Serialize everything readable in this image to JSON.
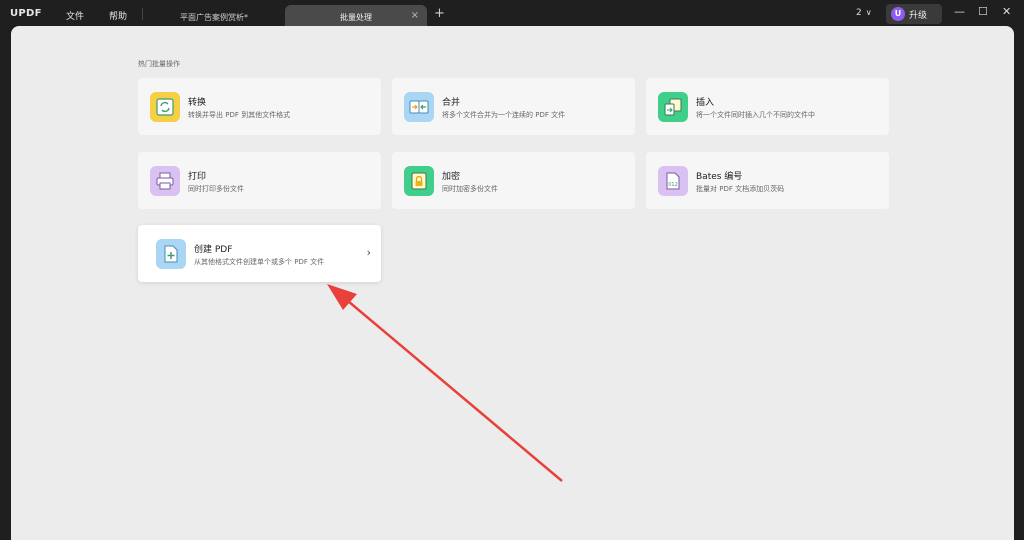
{
  "app": {
    "logo": "UPDF",
    "menu": [
      "文件",
      "帮助"
    ]
  },
  "tabs": [
    {
      "label": "平面广告案例赏析*",
      "active": false
    },
    {
      "label": "批量处理",
      "active": true,
      "close": "×"
    }
  ],
  "new_tab": "+",
  "page_indicator": {
    "value": "2",
    "chevron": "∨"
  },
  "upgrade": {
    "badge": "U",
    "label": "升级"
  },
  "window_controls": {
    "minimize": "—",
    "maximize": "☐",
    "close": "✕"
  },
  "section_title": "热门批量操作",
  "cards": [
    {
      "title": "转换",
      "desc": "转换并导出 PDF 到其他文件格式",
      "icon": "convert-icon",
      "color": "#f6cf45"
    },
    {
      "title": "合并",
      "desc": "将多个文件合并为一个连续的 PDF 文件",
      "icon": "merge-icon",
      "color": "#a9d6f2"
    },
    {
      "title": "插入",
      "desc": "将一个文件同时插入几个不同的文件中",
      "icon": "insert-icon",
      "color": "#3fcf8b"
    },
    {
      "title": "打印",
      "desc": "同时打印多份文件",
      "icon": "print-icon",
      "color": "#d9c2f2"
    },
    {
      "title": "加密",
      "desc": "同时加密多份文件",
      "icon": "lock-icon",
      "color": "#3fcf8b"
    },
    {
      "title": "Bates 编号",
      "desc": "批量对 PDF 文档添加贝茨码",
      "icon": "bates-icon",
      "color": "#d9c2f2"
    },
    {
      "title": "创建 PDF",
      "desc": "从其他格式文件创建单个或多个 PDF 文件",
      "icon": "create-pdf-icon",
      "color": "#a9d6f2",
      "chevron": "›"
    }
  ],
  "colors": {
    "accent": "#8e5cf2",
    "arrow": "#e8413c"
  }
}
